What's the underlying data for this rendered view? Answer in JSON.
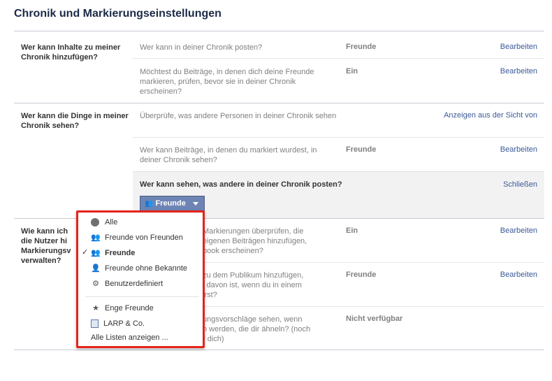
{
  "page": {
    "title": "Chronik und Markierungseinstellungen"
  },
  "sections": [
    {
      "label": "Wer kann Inhalte zu meiner Chronik hinzufügen?",
      "rows": [
        {
          "question": "Wer kann in deiner Chronik posten?",
          "value": "Freunde",
          "action": "Bearbeiten"
        },
        {
          "question": "Möchtest du Beiträge, in denen dich deine Freunde markieren, prüfen, bevor sie in deiner Chronik erscheinen?",
          "value": "Ein",
          "action": "Bearbeiten"
        }
      ]
    },
    {
      "label": "Wer kann die Dinge in meiner Chronik sehen?",
      "rows": [
        {
          "question": "Überprüfe, was andere Personen in deiner Chronik sehen",
          "value": "",
          "action": "Anzeigen aus der Sicht von"
        },
        {
          "question": "Wer kann Beiträge, in denen du markiert wurdest, in deiner Chronik sehen?",
          "value": "Freunde",
          "action": "Bearbeiten"
        }
      ],
      "expanded": {
        "title": "Wer kann sehen, was andere in deiner Chronik posten?",
        "close": "Schließen",
        "button_label": "Freunde"
      }
    },
    {
      "label": "Wie kann ich … die Nutzer hi… Markierungsv… verwalten?",
      "label_lines": [
        "Wie kann ich",
        "die Nutzer hi",
        "Markierungsv",
        "verwalten?"
      ],
      "rows": [
        {
          "question_lines": [
            "Markierungen überprüfen, die",
            "eigenen Beiträgen hinzufügen,",
            "book erscheinen?"
          ],
          "value": "Ein",
          "action": "Bearbeiten"
        },
        {
          "question_lines": [
            "zu dem Publikum hinzufügen,",
            "l davon ist, wenn du in einem",
            "irst?"
          ],
          "value": "Freunde",
          "action": "Bearbeiten"
        },
        {
          "question_lines": [
            "ungsvorschläge sehen, wenn",
            "n werden, die dir ähneln? (noch",
            "r dich)"
          ],
          "value": "Nicht verfügbar",
          "action": ""
        }
      ]
    }
  ],
  "dropdown": {
    "items": [
      {
        "label": "Alle",
        "icon": "globe-icon",
        "selected": false
      },
      {
        "label": "Freunde von Freunden",
        "icon": "friends-of-friends-icon",
        "selected": false
      },
      {
        "label": "Freunde",
        "icon": "friends-icon",
        "selected": true
      },
      {
        "label": "Freunde ohne Bekannte",
        "icon": "friends-except-acquaintances-icon",
        "selected": false
      },
      {
        "label": "Benutzerdefiniert",
        "icon": "gear-icon",
        "selected": false
      },
      {
        "label": "Enge Freunde",
        "icon": "star-icon",
        "selected": false
      },
      {
        "label": "LARP & Co.",
        "icon": "list-icon",
        "selected": false
      }
    ],
    "footer": "Alle Listen anzeigen ...",
    "check_glyph": "✓",
    "highlight_color": "#e4231b"
  },
  "colors": {
    "link": "#3b5998",
    "title": "#1c2a47",
    "button": "#6d84b4"
  }
}
